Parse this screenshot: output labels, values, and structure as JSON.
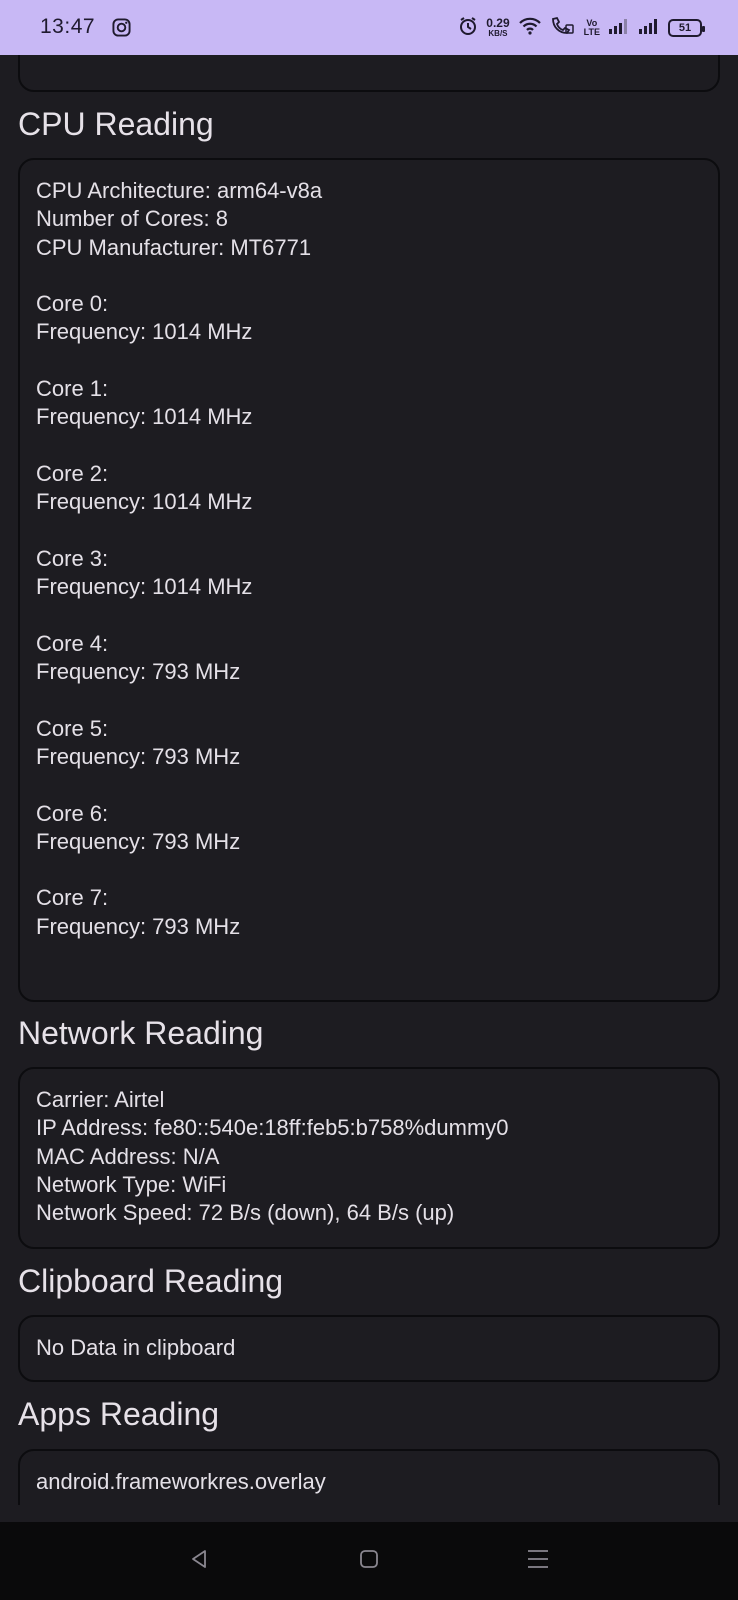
{
  "status_bar": {
    "time": "13:47",
    "net_speed_value": "0.29",
    "net_speed_unit": "KB/S",
    "volte_top": "Vo",
    "volte_bottom": "LTE",
    "battery": "51"
  },
  "sections": {
    "cpu": {
      "title": "CPU Reading",
      "text": "CPU Architecture: arm64-v8a\nNumber of Cores: 8\nCPU Manufacturer: MT6771\n\nCore 0:\nFrequency: 1014 MHz\n\nCore 1:\nFrequency: 1014 MHz\n\nCore 2:\nFrequency: 1014 MHz\n\nCore 3:\nFrequency: 1014 MHz\n\nCore 4:\nFrequency: 793 MHz\n\nCore 5:\nFrequency: 793 MHz\n\nCore 6:\nFrequency: 793 MHz\n\nCore 7:\nFrequency: 793 MHz"
    },
    "network": {
      "title": "Network Reading",
      "text": "Carrier: Airtel\nIP Address: fe80::540e:18ff:feb5:b758%dummy0\nMAC Address: N/A\nNetwork Type: WiFi\nNetwork Speed: 72 B/s (down), 64 B/s (up)"
    },
    "clipboard": {
      "title": "Clipboard Reading",
      "text": "No Data in clipboard"
    },
    "apps": {
      "title": "Apps Reading",
      "text": "android.frameworkres.overlay"
    }
  },
  "icons": {
    "status": [
      "instagram-icon",
      "alarm-icon",
      "wifi-icon",
      "wifi-calling-icon",
      "signal-icon",
      "battery-icon"
    ],
    "nav": [
      "back-icon",
      "home-icon",
      "recents-icon"
    ]
  },
  "colors": {
    "status_bar_bg": "#c8b8f5",
    "app_bg": "#1d1c21",
    "card_border": "#0c0c0f",
    "text": "#e4e0e7",
    "nav_bar_bg": "#0a0a0b"
  }
}
